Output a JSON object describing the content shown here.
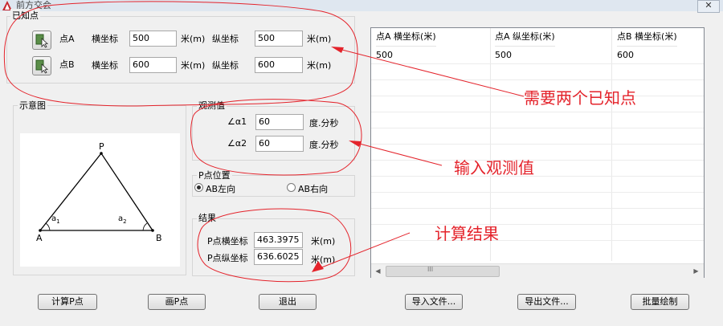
{
  "window": {
    "title": "前方交会",
    "close": "✕"
  },
  "known": {
    "label": "已知点",
    "pointA": {
      "name": "点A",
      "x_label": "横坐标",
      "x_value": "500",
      "x_unit": "米(m)",
      "y_label": "纵坐标",
      "y_value": "500",
      "y_unit": "米(m)"
    },
    "pointB": {
      "name": "点B",
      "x_label": "横坐标",
      "x_value": "600",
      "x_unit": "米(m)",
      "y_label": "纵坐标",
      "y_value": "600",
      "y_unit": "米(m)"
    }
  },
  "diagram": {
    "label": "示意图",
    "P": "P",
    "A": "A",
    "B": "B",
    "a1": "a",
    "a1_sub": "1",
    "a2": "a",
    "a2_sub": "2"
  },
  "observe": {
    "label": "观测值",
    "alpha1_label": "∠α1",
    "alpha1_value": "60",
    "alpha1_unit": "度.分秒",
    "alpha2_label": "∠α2",
    "alpha2_value": "60",
    "alpha2_unit": "度.分秒"
  },
  "ppos": {
    "label": "P点位置",
    "left": "AB左向",
    "right": "AB右向",
    "selected": "left"
  },
  "result": {
    "label": "结果",
    "x_label": "P点横坐标",
    "x_value": "463.3975",
    "x_unit": "米(m)",
    "y_label": "P点纵坐标",
    "y_value": "636.6025",
    "y_unit": "米(m)"
  },
  "table": {
    "columns": [
      "点A 横坐标(米)",
      "点A 纵坐标(米)",
      "点B 横坐标(米)"
    ],
    "rows": [
      [
        "500",
        "500",
        "600"
      ]
    ],
    "hscroll_grip": "III"
  },
  "annotations": {
    "need_points": "需要两个已知点",
    "input_obs": "输入观测值",
    "calc_result": "计算结果"
  },
  "buttons": {
    "calc": "计算P点",
    "draw": "画P点",
    "exit": "退出",
    "import": "导入文件...",
    "export": "导出文件...",
    "batch": "批量绘制"
  },
  "colors": {
    "annotation": "#e4232b"
  }
}
